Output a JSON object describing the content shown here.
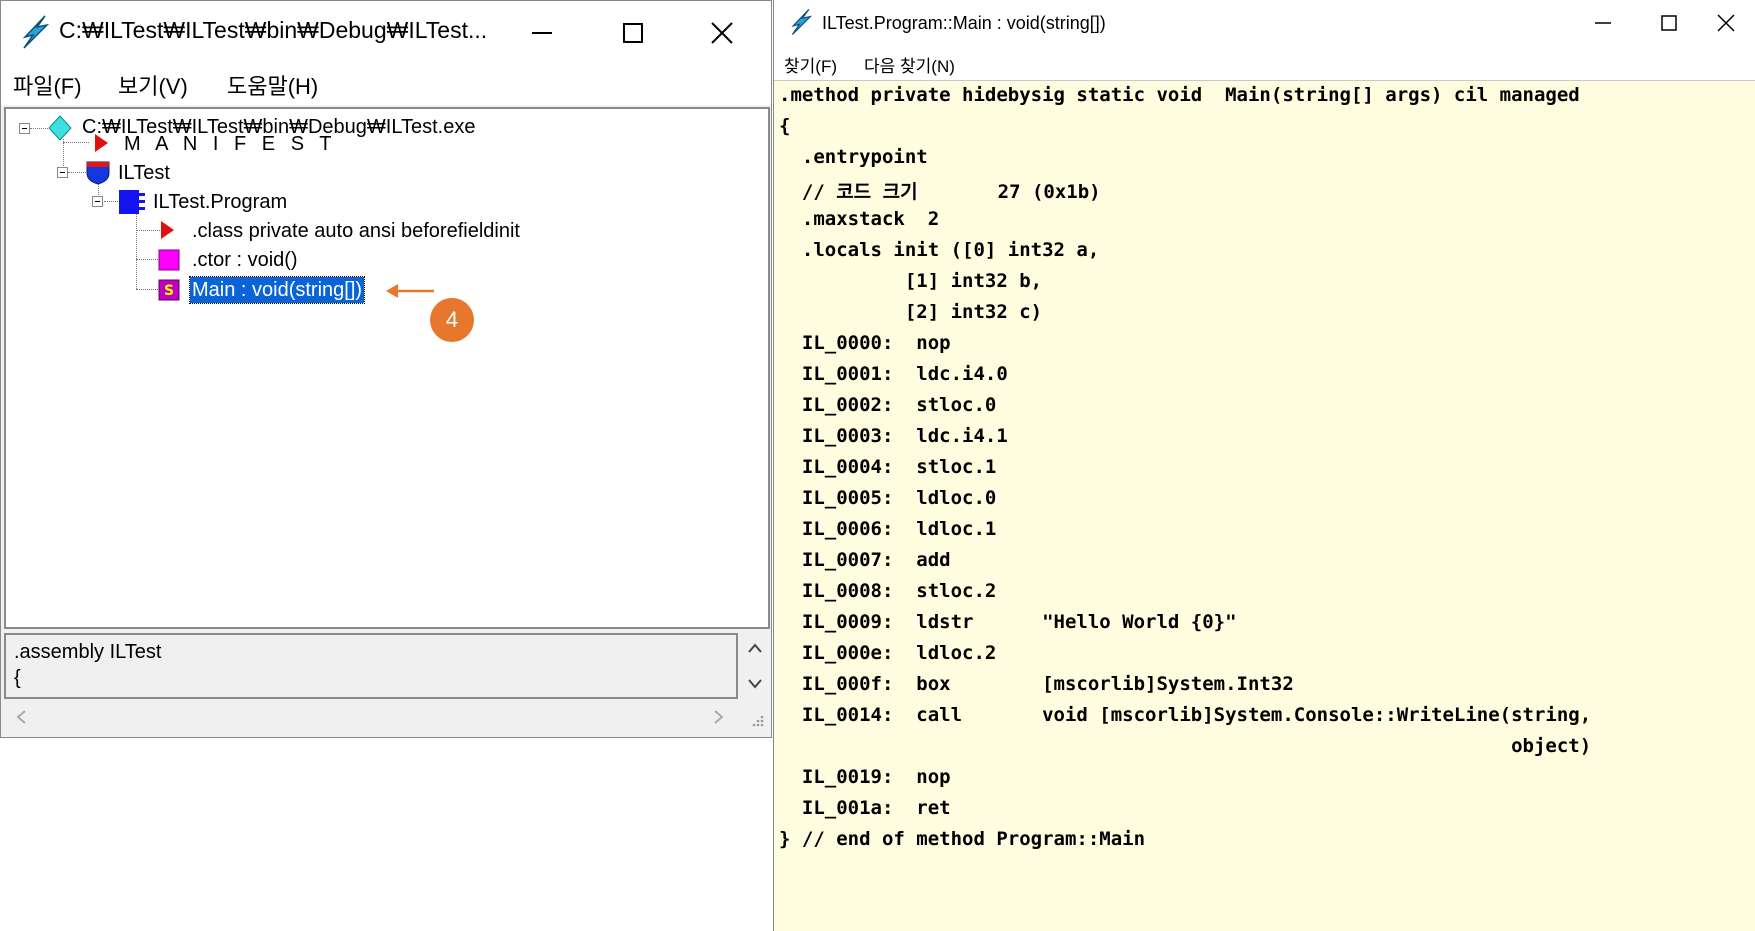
{
  "left_window": {
    "title": "C:₩ILTest₩ILTest₩bin₩Debug₩ILTest...",
    "menu": [
      "파일(F)",
      "보기(V)",
      "도움말(H)"
    ],
    "tree": [
      {
        "label": "C:₩ILTest₩ILTest₩bin₩Debug₩ILTest.exe"
      },
      {
        "label": "M A N I F E S T"
      },
      {
        "label": "ILTest"
      },
      {
        "label": "ILTest.Program"
      },
      {
        "label": ".class private auto ansi beforefieldinit"
      },
      {
        "label": ".ctor : void()"
      },
      {
        "label": "Main : void(string[])"
      }
    ],
    "info_lines": [
      ".assembly ILTest",
      "{"
    ],
    "callout": "4",
    "colors": {
      "selection": "#0a64d8",
      "callout": "#e8772e"
    }
  },
  "right_window": {
    "title": "ILTest.Program::Main : void(string[])",
    "menu": [
      "찾기(F)",
      "다음 찾기(N)"
    ],
    "background": "#fffde0",
    "code": [
      ".method private hidebysig static void  Main(string[] args) cil managed",
      "{",
      "  .entrypoint",
      "  // 코드 크기       27 (0x1b)",
      "  .maxstack  2",
      "  .locals init ([0] int32 a,",
      "           [1] int32 b,",
      "           [2] int32 c)",
      "  IL_0000:  nop",
      "  IL_0001:  ldc.i4.0",
      "  IL_0002:  stloc.0",
      "  IL_0003:  ldc.i4.1",
      "  IL_0004:  stloc.1",
      "  IL_0005:  ldloc.0",
      "  IL_0006:  ldloc.1",
      "  IL_0007:  add",
      "  IL_0008:  stloc.2",
      "  IL_0009:  ldstr      \"Hello World {0}\"",
      "  IL_000e:  ldloc.2",
      "  IL_000f:  box        [mscorlib]System.Int32",
      "  IL_0014:  call       void [mscorlib]System.Console::WriteLine(string,",
      "                                                                object)",
      "  IL_0019:  nop",
      "  IL_001a:  ret",
      "} // end of method Program::Main"
    ]
  }
}
